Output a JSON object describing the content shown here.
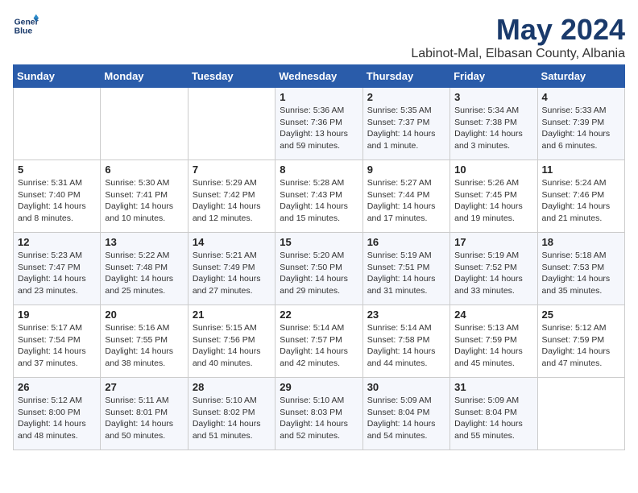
{
  "header": {
    "logo_line1": "General",
    "logo_line2": "Blue",
    "month_year": "May 2024",
    "location": "Labinot-Mal, Elbasan County, Albania"
  },
  "weekdays": [
    "Sunday",
    "Monday",
    "Tuesday",
    "Wednesday",
    "Thursday",
    "Friday",
    "Saturday"
  ],
  "weeks": [
    [
      {
        "day": "",
        "sunrise": "",
        "sunset": "",
        "daylight": ""
      },
      {
        "day": "",
        "sunrise": "",
        "sunset": "",
        "daylight": ""
      },
      {
        "day": "",
        "sunrise": "",
        "sunset": "",
        "daylight": ""
      },
      {
        "day": "1",
        "sunrise": "5:36 AM",
        "sunset": "7:36 PM",
        "daylight": "13 hours and 59 minutes."
      },
      {
        "day": "2",
        "sunrise": "5:35 AM",
        "sunset": "7:37 PM",
        "daylight": "14 hours and 1 minute."
      },
      {
        "day": "3",
        "sunrise": "5:34 AM",
        "sunset": "7:38 PM",
        "daylight": "14 hours and 3 minutes."
      },
      {
        "day": "4",
        "sunrise": "5:33 AM",
        "sunset": "7:39 PM",
        "daylight": "14 hours and 6 minutes."
      }
    ],
    [
      {
        "day": "5",
        "sunrise": "5:31 AM",
        "sunset": "7:40 PM",
        "daylight": "14 hours and 8 minutes."
      },
      {
        "day": "6",
        "sunrise": "5:30 AM",
        "sunset": "7:41 PM",
        "daylight": "14 hours and 10 minutes."
      },
      {
        "day": "7",
        "sunrise": "5:29 AM",
        "sunset": "7:42 PM",
        "daylight": "14 hours and 12 minutes."
      },
      {
        "day": "8",
        "sunrise": "5:28 AM",
        "sunset": "7:43 PM",
        "daylight": "14 hours and 15 minutes."
      },
      {
        "day": "9",
        "sunrise": "5:27 AM",
        "sunset": "7:44 PM",
        "daylight": "14 hours and 17 minutes."
      },
      {
        "day": "10",
        "sunrise": "5:26 AM",
        "sunset": "7:45 PM",
        "daylight": "14 hours and 19 minutes."
      },
      {
        "day": "11",
        "sunrise": "5:24 AM",
        "sunset": "7:46 PM",
        "daylight": "14 hours and 21 minutes."
      }
    ],
    [
      {
        "day": "12",
        "sunrise": "5:23 AM",
        "sunset": "7:47 PM",
        "daylight": "14 hours and 23 minutes."
      },
      {
        "day": "13",
        "sunrise": "5:22 AM",
        "sunset": "7:48 PM",
        "daylight": "14 hours and 25 minutes."
      },
      {
        "day": "14",
        "sunrise": "5:21 AM",
        "sunset": "7:49 PM",
        "daylight": "14 hours and 27 minutes."
      },
      {
        "day": "15",
        "sunrise": "5:20 AM",
        "sunset": "7:50 PM",
        "daylight": "14 hours and 29 minutes."
      },
      {
        "day": "16",
        "sunrise": "5:19 AM",
        "sunset": "7:51 PM",
        "daylight": "14 hours and 31 minutes."
      },
      {
        "day": "17",
        "sunrise": "5:19 AM",
        "sunset": "7:52 PM",
        "daylight": "14 hours and 33 minutes."
      },
      {
        "day": "18",
        "sunrise": "5:18 AM",
        "sunset": "7:53 PM",
        "daylight": "14 hours and 35 minutes."
      }
    ],
    [
      {
        "day": "19",
        "sunrise": "5:17 AM",
        "sunset": "7:54 PM",
        "daylight": "14 hours and 37 minutes."
      },
      {
        "day": "20",
        "sunrise": "5:16 AM",
        "sunset": "7:55 PM",
        "daylight": "14 hours and 38 minutes."
      },
      {
        "day": "21",
        "sunrise": "5:15 AM",
        "sunset": "7:56 PM",
        "daylight": "14 hours and 40 minutes."
      },
      {
        "day": "22",
        "sunrise": "5:14 AM",
        "sunset": "7:57 PM",
        "daylight": "14 hours and 42 minutes."
      },
      {
        "day": "23",
        "sunrise": "5:14 AM",
        "sunset": "7:58 PM",
        "daylight": "14 hours and 44 minutes."
      },
      {
        "day": "24",
        "sunrise": "5:13 AM",
        "sunset": "7:59 PM",
        "daylight": "14 hours and 45 minutes."
      },
      {
        "day": "25",
        "sunrise": "5:12 AM",
        "sunset": "7:59 PM",
        "daylight": "14 hours and 47 minutes."
      }
    ],
    [
      {
        "day": "26",
        "sunrise": "5:12 AM",
        "sunset": "8:00 PM",
        "daylight": "14 hours and 48 minutes."
      },
      {
        "day": "27",
        "sunrise": "5:11 AM",
        "sunset": "8:01 PM",
        "daylight": "14 hours and 50 minutes."
      },
      {
        "day": "28",
        "sunrise": "5:10 AM",
        "sunset": "8:02 PM",
        "daylight": "14 hours and 51 minutes."
      },
      {
        "day": "29",
        "sunrise": "5:10 AM",
        "sunset": "8:03 PM",
        "daylight": "14 hours and 52 minutes."
      },
      {
        "day": "30",
        "sunrise": "5:09 AM",
        "sunset": "8:04 PM",
        "daylight": "14 hours and 54 minutes."
      },
      {
        "day": "31",
        "sunrise": "5:09 AM",
        "sunset": "8:04 PM",
        "daylight": "14 hours and 55 minutes."
      },
      {
        "day": "",
        "sunrise": "",
        "sunset": "",
        "daylight": ""
      }
    ]
  ],
  "labels": {
    "sunrise": "Sunrise:",
    "sunset": "Sunset:",
    "daylight": "Daylight:"
  }
}
